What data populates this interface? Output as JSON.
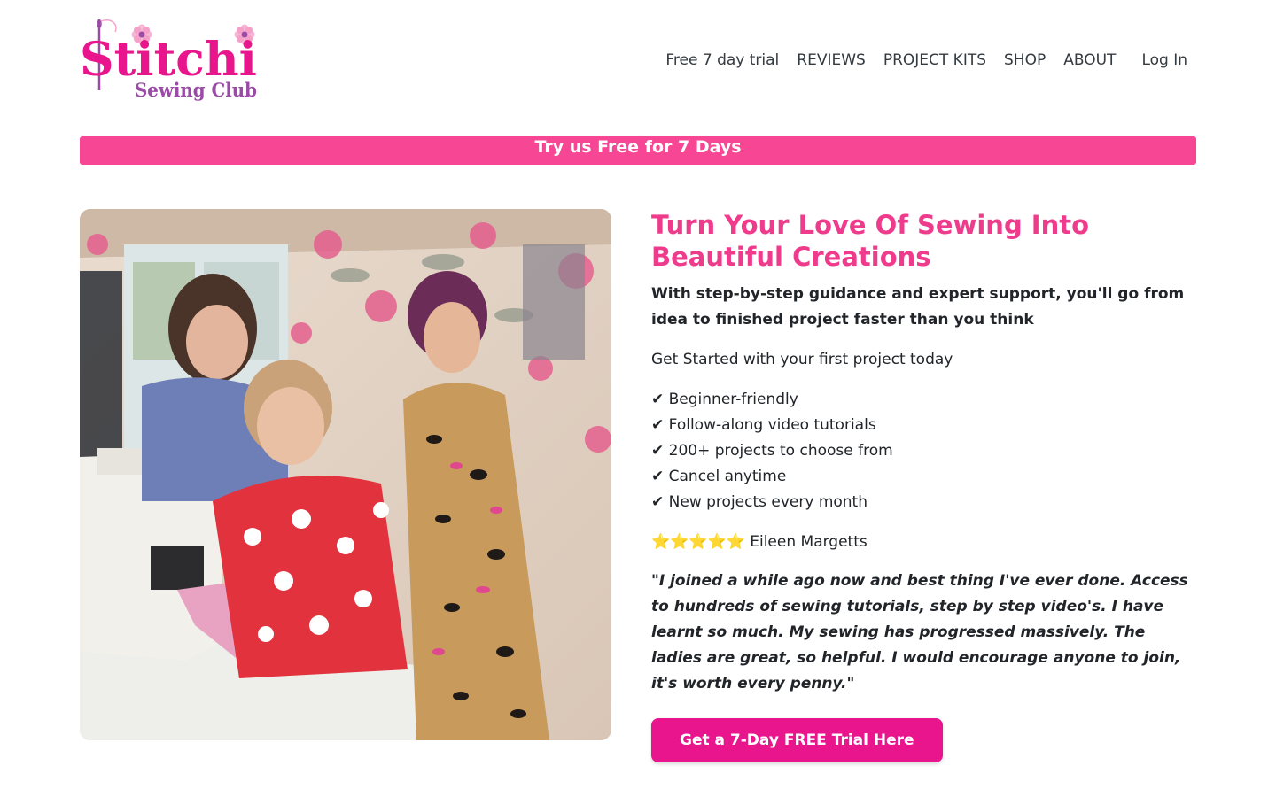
{
  "brand": {
    "logo_word": "Stitchi",
    "logo_sub": "Sewing Club",
    "colors": {
      "pink": "#e8158c",
      "purple": "#9a4ba6"
    }
  },
  "nav": {
    "items": [
      "Free 7 day trial",
      "REVIEWS",
      "PROJECT KITS",
      "SHOP",
      "ABOUT"
    ],
    "login": "Log In"
  },
  "banner": {
    "text": "Try us Free for 7 Days",
    "color": "#f74693"
  },
  "hero": {
    "title": "Turn Your Love Of Sewing Into Beautiful Creations",
    "subtitle": "With step-by-step guidance and expert support, you'll go from idea to finished project faster than you think",
    "lead": "Get Started with your first project today",
    "benefits": [
      "✔ Beginner-friendly",
      "✔ Follow-along video tutorials",
      "✔ 200+ projects to choose from",
      "✔ Cancel anytime",
      "✔ New projects every month"
    ],
    "review_rating": "⭐⭐⭐⭐⭐ Eileen Margetts",
    "testimonial": "\"I joined  a while ago now and best thing I've ever done. Access to hundreds of sewing tutorials, step by step video's. I have learnt so much. My sewing has progressed massively. The ladies are great, so helpful. I would encourage anyone to join, it's worth every penny.\"",
    "cta_label": "Get a 7-Day FREE Trial Here",
    "title_color": "#ef3b8c"
  }
}
